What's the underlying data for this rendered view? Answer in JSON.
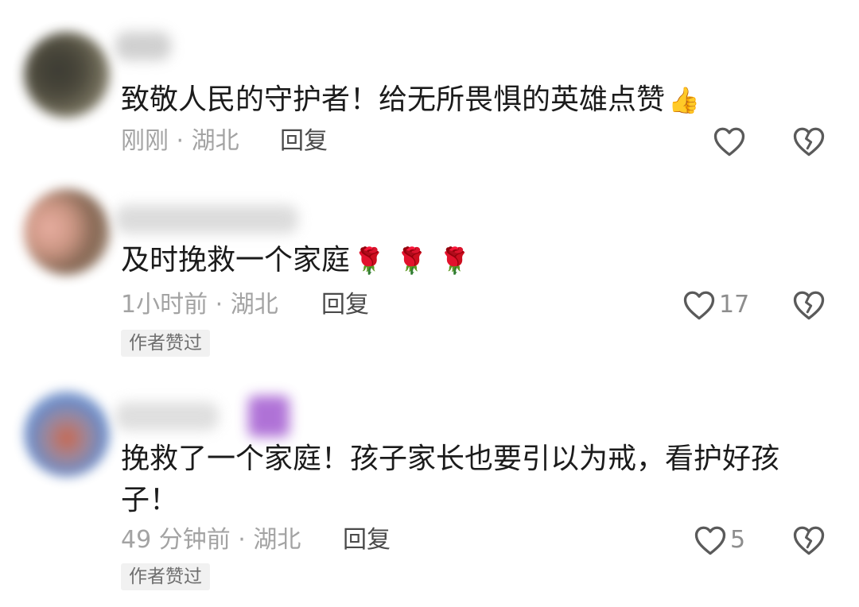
{
  "comments": [
    {
      "text": "致敬人民的守护者！给无所畏惧的英雄点赞",
      "emoji": "👍",
      "time_location": "刚刚 · 湖北",
      "reply_label": "回复",
      "like_count": "",
      "author_badge": ""
    },
    {
      "text": "及时挽救一个家庭",
      "emoji": "🌹",
      "time_location": "1小时前 · 湖北",
      "reply_label": "回复",
      "like_count": "17",
      "author_badge": "作者赞过"
    },
    {
      "text": "挽救了一个家庭！孩子家长也要引以为戒，看护好孩子！",
      "emoji": "",
      "time_location": "49 分钟前 · 湖北",
      "reply_label": "回复",
      "like_count": "5",
      "author_badge": "作者赞过"
    }
  ],
  "icons": {
    "like": "heart-outline-icon",
    "dislike": "broken-heart-icon"
  },
  "colors": {
    "text": "#1b1b1b",
    "meta": "#a3a3a3",
    "reply": "#4a4a4a",
    "icon": "#5a5a5a",
    "badge_bg": "#f1f1f1"
  }
}
